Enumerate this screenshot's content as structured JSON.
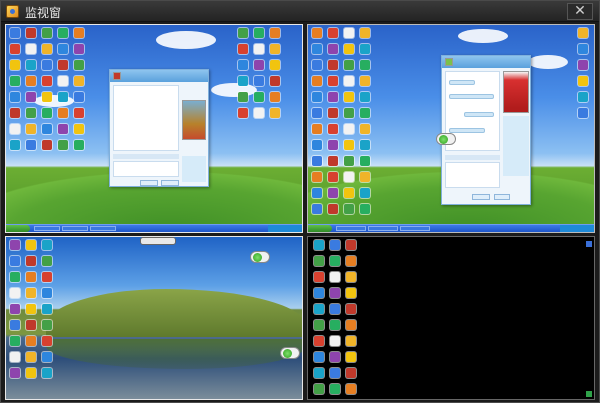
{
  "window": {
    "title": "监视窗",
    "close_label": "✕",
    "icons": {
      "app": "app-logo-icon",
      "close": "close-icon"
    }
  },
  "screens": [
    {
      "id": "screen-1",
      "wallpaper": "bliss",
      "has_taskbar": true,
      "chat_window": "open"
    },
    {
      "id": "screen-2",
      "wallpaper": "bliss",
      "has_taskbar": true,
      "chat_window": "open-with-image-panel"
    },
    {
      "id": "screen-3",
      "wallpaper": "lake",
      "has_taskbar": false,
      "chat_window": "none"
    },
    {
      "id": "screen-4",
      "wallpaper": "black",
      "has_taskbar": false,
      "chat_window": "none"
    }
  ],
  "colors": {
    "titlebar": "#2b2b2b",
    "xp_taskbar": "#2a62d3",
    "xp_start": "#3c9a2e",
    "chat_frame": "#7fb0dc",
    "widget_green": "#3aa52a"
  }
}
